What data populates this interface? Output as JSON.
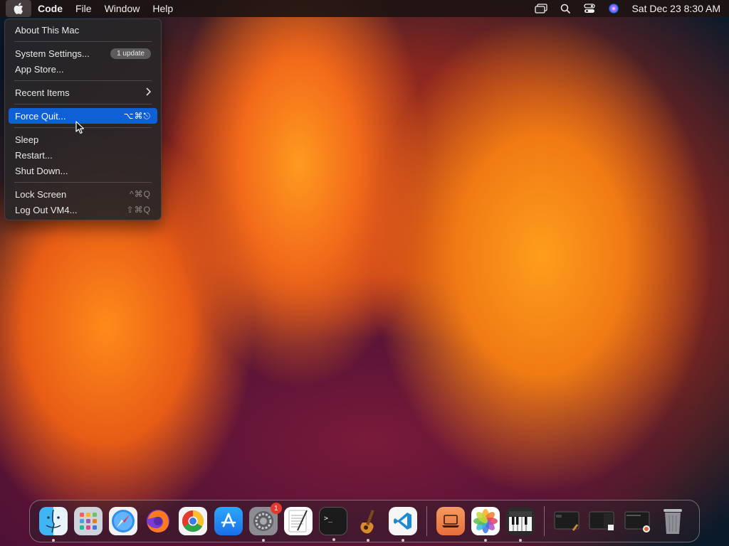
{
  "menubar": {
    "app_name": "Code",
    "menus": [
      "File",
      "Window",
      "Help"
    ],
    "clock": "Sat Dec 23  8:30 AM",
    "status_icons": [
      "screen-mirroring-icon",
      "spotlight-search-icon",
      "control-center-icon",
      "siri-icon"
    ]
  },
  "apple_menu": {
    "about": "About This Mac",
    "system_settings": "System Settings...",
    "system_settings_badge": "1 update",
    "app_store": "App Store...",
    "recent_items": "Recent Items",
    "force_quit": "Force Quit...",
    "force_quit_shortcut": "⌥⌘⎋",
    "sleep": "Sleep",
    "restart": "Restart...",
    "shut_down": "Shut Down...",
    "lock_screen": "Lock Screen",
    "lock_screen_shortcut": "^⌘Q",
    "log_out": "Log Out VM4...",
    "log_out_shortcut": "⇧⌘Q"
  },
  "dock": {
    "system_settings_badge": "1",
    "apps": [
      "Finder",
      "Launchpad",
      "Safari",
      "Firefox",
      "Chrome",
      "App Store",
      "System Settings",
      "TextEdit",
      "Terminal",
      "GarageBand",
      "Visual Studio Code",
      "Mac",
      "Photos",
      "Piano"
    ],
    "running": [
      "Finder",
      "System Settings",
      "Terminal",
      "GarageBand",
      "Visual Studio Code",
      "Photos",
      "Piano"
    ]
  },
  "colors": {
    "highlight": "#0f5fd7",
    "menubar_bg": "#1e1412",
    "badge_red": "#e5382f"
  }
}
